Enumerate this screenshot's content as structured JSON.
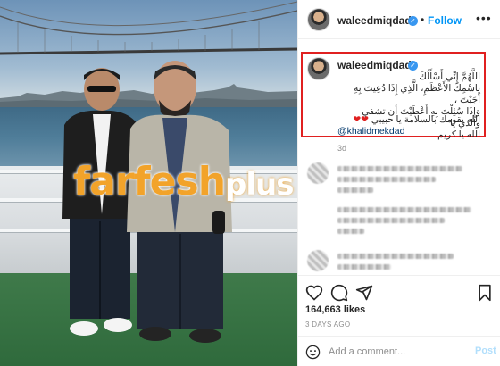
{
  "post": {
    "author": "waleedmiqdad",
    "follow_label": "Follow",
    "more_label": "•••",
    "separator": "•",
    "verified_mark": "✓",
    "caption_lines": [
      "اللَّهُمَّ إِنِّي أَسْأَلُكَ",
      "بِاسْمِكَ الأَعْظَمِ، الَّذِي إِذَا دُعِيتَ بِهِ أَجَبْتَ ،",
      "وَإِذَا سُئِلْتَ بِهِ أَعْطَيْتَ أن تشفي والدي يا",
      "الله يا كريم"
    ],
    "caption_last_line": "الله يقومك بالسلامة يا حبيبي",
    "hearts": "❤❤",
    "mention": "@khalidmekdad",
    "caption_age": "3d",
    "likes": "164,663 likes",
    "posted_ago": "3 DAYS AGO",
    "comment_placeholder": "Add a comment...",
    "post_button": "Post"
  },
  "watermark": {
    "main": "farfesh",
    "suffix": "plus"
  },
  "icons": {
    "like": "heart-icon",
    "comment": "comment-icon",
    "share": "share-icon",
    "save": "bookmark-icon",
    "emoji": "smiley-icon",
    "more": "more-options-icon"
  },
  "colors": {
    "link_blue": "#0095f6",
    "verified_blue": "#3897f0",
    "mention": "#00376b",
    "highlight_box": "#e02020",
    "watermark_orange": "#f2a32a"
  }
}
